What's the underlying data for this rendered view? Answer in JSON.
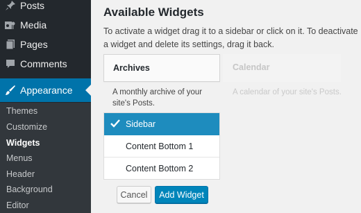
{
  "sidebar": {
    "menu": [
      {
        "label": "Posts",
        "icon": "pin-icon"
      },
      {
        "label": "Media",
        "icon": "media-icon"
      },
      {
        "label": "Pages",
        "icon": "pages-icon"
      },
      {
        "label": "Comments",
        "icon": "comment-icon"
      },
      {
        "label": "Appearance",
        "icon": "brush-icon"
      }
    ],
    "submenu": [
      "Themes",
      "Customize",
      "Widgets",
      "Menus",
      "Header",
      "Background",
      "Editor"
    ],
    "current_sub": "Widgets",
    "active_color": "#0073aa"
  },
  "main": {
    "heading": "Available Widgets",
    "description": "To activate a widget drag it to a sidebar or click on it. To deactivate a widget and delete its settings, drag it back.",
    "widgets": [
      {
        "title": "Archives",
        "desc": "A monthly archive of your site's Posts."
      },
      {
        "title": "Calendar",
        "desc": "A calendar of your site's Posts."
      }
    ],
    "chooser": {
      "options": [
        "Sidebar",
        "Content Bottom 1",
        "Content Bottom 2"
      ],
      "selected": "Sidebar"
    },
    "buttons": {
      "cancel": "Cancel",
      "add": "Add Widget"
    }
  }
}
